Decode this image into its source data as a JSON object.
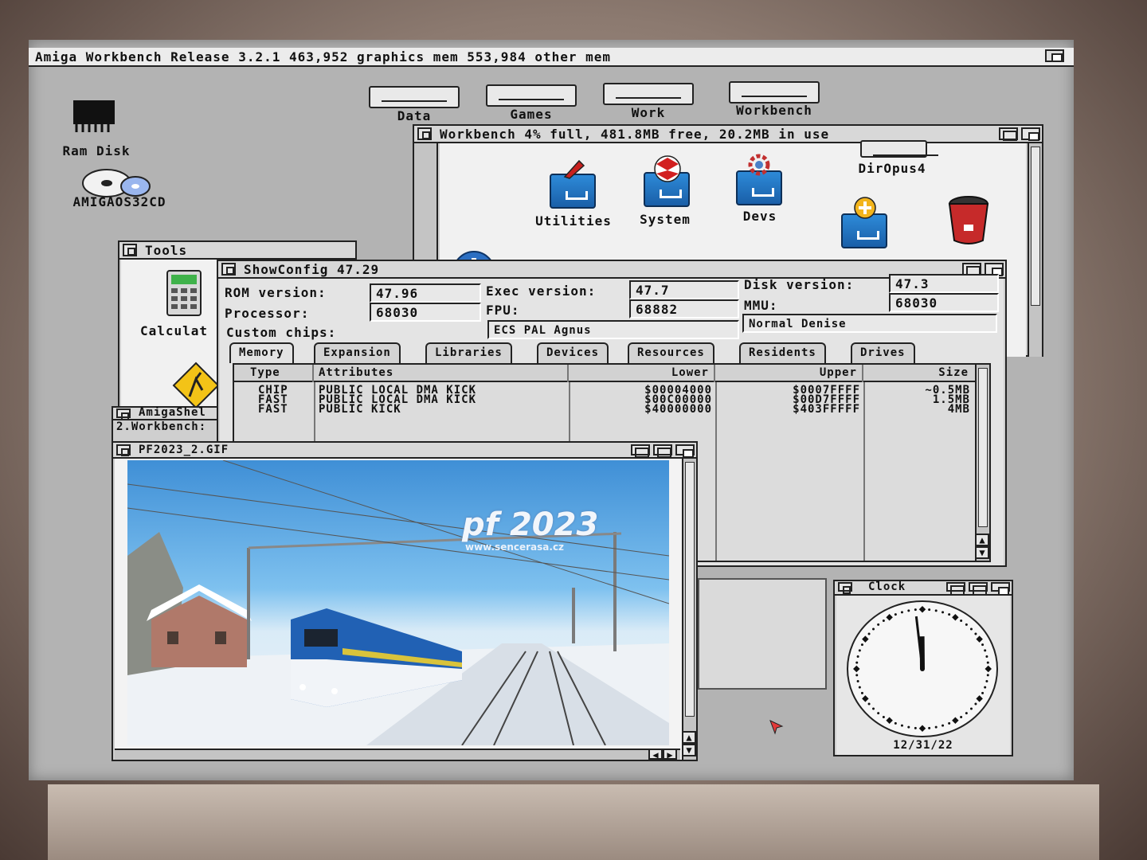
{
  "screen": {
    "title": "Amiga Workbench Release 3.2.1  463,952 graphics mem  553,984 other mem"
  },
  "desktop_icons": [
    {
      "label": "Ram Disk",
      "icon": "ram-chip-icon"
    },
    {
      "label": "AMIGAOS32CD",
      "icon": "cd-icon"
    }
  ],
  "drives": [
    {
      "label": "Data"
    },
    {
      "label": "Games"
    },
    {
      "label": "Work"
    },
    {
      "label": "Workbench"
    }
  ],
  "workbench_window": {
    "title": "Workbench  4% full, 481.8MB free, 20.2MB in use",
    "icons": [
      {
        "label": "Utilities",
        "icon": "drawer-icon"
      },
      {
        "label": "System",
        "icon": "drawer-icon"
      },
      {
        "label": "Devs",
        "icon": "drawer-icon"
      },
      {
        "label": "DirOpus4",
        "icon": "drive-icon"
      },
      {
        "label": "",
        "icon": "prefs-drawer-icon"
      },
      {
        "label": "",
        "icon": "trashcan-icon"
      },
      {
        "label": "",
        "icon": "joystick-icon"
      }
    ]
  },
  "tools_window": {
    "title": "Tools",
    "icons": [
      {
        "label": "Calculat",
        "icon": "calculator-icon"
      },
      {
        "label": "",
        "icon": "road-sign-icon"
      }
    ]
  },
  "showconfig": {
    "title": "ShowConfig 47.29",
    "rom_label": "ROM version:",
    "rom_value": "47.96",
    "exec_label": "Exec version:",
    "exec_value": "47.7",
    "disk_label": "Disk version:",
    "disk_value": "47.3",
    "processor_label": "Processor:",
    "processor_value": "68030",
    "fpu_label": "FPU:",
    "fpu_value": "68882",
    "mmu_label": "MMU:",
    "mmu_value": "68030",
    "chips_label": "Custom chips:",
    "agnus_value": "ECS PAL Agnus",
    "denise_value": "Normal Denise",
    "tabs": [
      "Memory",
      "Expansion",
      "Libraries",
      "Devices",
      "Resources",
      "Residents",
      "Drives"
    ],
    "columns": [
      "Type",
      "Attributes",
      "Lower",
      "Upper",
      "Size"
    ],
    "rows": [
      {
        "type": "CHIP",
        "attributes": "PUBLIC LOCAL DMA KICK",
        "lower": "$00004000",
        "upper": "$0007FFFF",
        "size": "~0.5MB"
      },
      {
        "type": "FAST",
        "attributes": "PUBLIC LOCAL DMA KICK",
        "lower": "$00C00000",
        "upper": "$00D7FFFF",
        "size": "1.5MB"
      },
      {
        "type": "FAST",
        "attributes": "PUBLIC KICK",
        "lower": "$40000000",
        "upper": "$403FFFFF",
        "size": "4MB"
      }
    ]
  },
  "amigashell": {
    "title": "AmigaShel",
    "prompt": "2.Workbench:"
  },
  "image_window": {
    "title": "PF2023_2.GIF",
    "overlay_text": "pf 2023",
    "overlay_url": "www.sencerasa.cz"
  },
  "clock": {
    "title": "Clock",
    "date": "12/31/22",
    "hour": 11,
    "minute": 59
  },
  "colors": {
    "workbench_grey": "#b3b3b3",
    "window_bg": "#cfcfcf",
    "drawer_blue": "#2d8ad8",
    "sky_blue": "#3f8fd6",
    "train_blue": "#2161b4"
  }
}
